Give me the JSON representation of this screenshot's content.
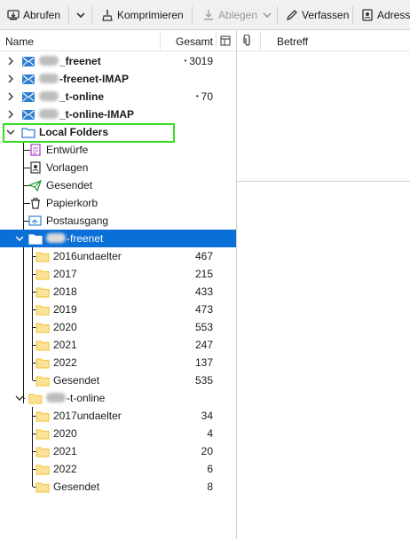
{
  "toolbar": {
    "get_messages": "Abrufen",
    "compact": "Komprimieren",
    "archive": "Ablegen",
    "write": "Verfassen",
    "address_book": "Adress"
  },
  "columns": {
    "name": "Name",
    "total": "Gesamt",
    "subject": "Betreff"
  },
  "accounts": [
    {
      "suffix": "_freenet",
      "count": "3019",
      "unread_marker": "•"
    },
    {
      "suffix": "-freenet-IMAP",
      "count": ""
    },
    {
      "suffix": "_t-online",
      "count": "70",
      "unread_marker": "•"
    },
    {
      "suffix": "_t-online-IMAP",
      "count": ""
    }
  ],
  "local_folders": {
    "label": "Local Folders",
    "special": [
      "Entwürfe",
      "Vorlagen",
      "Gesendet",
      "Papierkorb",
      "Postausgang"
    ]
  },
  "freenet": {
    "label": "-freenet",
    "folders": [
      {
        "name": "2016undaelter",
        "count": "467"
      },
      {
        "name": "2017",
        "count": "215"
      },
      {
        "name": "2018",
        "count": "433"
      },
      {
        "name": "2019",
        "count": "473"
      },
      {
        "name": "2020",
        "count": "553"
      },
      {
        "name": "2021",
        "count": "247"
      },
      {
        "name": "2022",
        "count": "137"
      },
      {
        "name": "Gesendet",
        "count": "535"
      }
    ]
  },
  "tonline": {
    "label": "-t-online",
    "folders": [
      {
        "name": "2017undaelter",
        "count": "34"
      },
      {
        "name": "2020",
        "count": "4"
      },
      {
        "name": "2021",
        "count": "20"
      },
      {
        "name": "2022",
        "count": "6"
      },
      {
        "name": "Gesendet",
        "count": "8"
      }
    ]
  },
  "colors": {
    "selection": "#0a6fd6",
    "focus_outline": "#33dd22",
    "folder_yellow": "#f7c948",
    "account_blue": "#2f7fd1"
  }
}
